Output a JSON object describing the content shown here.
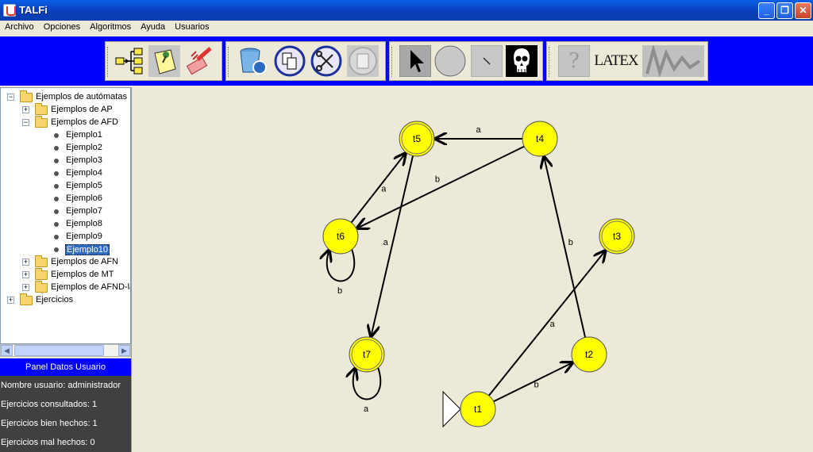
{
  "window": {
    "title": "TALFi",
    "min_label": "_",
    "max_label": "❐",
    "close_label": "✕"
  },
  "menu": [
    "Archivo",
    "Opciones",
    "Algoritmos",
    "Ayuda",
    "Usuarios"
  ],
  "toolbar": {
    "latex_label": "LATEX",
    "help_label": "?"
  },
  "tree": {
    "root": "Ejemplos de autómatas",
    "ap": "Ejemplos de AP",
    "afd": "Ejemplos de AFD",
    "afd_items": [
      "Ejemplo1",
      "Ejemplo2",
      "Ejemplo3",
      "Ejemplo4",
      "Ejemplo5",
      "Ejemplo6",
      "Ejemplo7",
      "Ejemplo8",
      "Ejemplo9",
      "Ejemplo10"
    ],
    "selected": "Ejemplo10",
    "afn": "Ejemplos de AFN",
    "mt": "Ejemplos de MT",
    "afnd": "Ejemplos de AFND-lan",
    "ejercicios": "Ejercicios"
  },
  "user_panel": {
    "header": "Panel Datos Usuario",
    "username": "Nombre usuario: administrador",
    "consulted": "Ejercicios consultados: 1",
    "correct": "Ejercicios bien hechos: 1",
    "wrong": "Ejercicios mal hechos: 0"
  },
  "automaton": {
    "states": [
      {
        "name": "t1",
        "initial": true,
        "final": false
      },
      {
        "name": "t2",
        "initial": false,
        "final": false
      },
      {
        "name": "t3",
        "initial": false,
        "final": true
      },
      {
        "name": "t4",
        "initial": false,
        "final": false
      },
      {
        "name": "t5",
        "initial": false,
        "final": true
      },
      {
        "name": "t6",
        "initial": false,
        "final": false
      },
      {
        "name": "t7",
        "initial": false,
        "final": true
      }
    ],
    "transitions": [
      {
        "from": "t1",
        "to": "t2",
        "label": "b"
      },
      {
        "from": "t1",
        "to": "t3",
        "label": "a"
      },
      {
        "from": "t2",
        "to": "t4",
        "label": "b"
      },
      {
        "from": "t4",
        "to": "t5",
        "label": "a"
      },
      {
        "from": "t4",
        "to": "t6",
        "label": "b"
      },
      {
        "from": "t6",
        "to": "t5",
        "label": "a"
      },
      {
        "from": "t5",
        "to": "t7",
        "label": "a"
      },
      {
        "from": "t6",
        "to": "t6",
        "label": "b"
      },
      {
        "from": "t7",
        "to": "t7",
        "label": "a"
      }
    ],
    "colors": {
      "state_fill": "#ffff00",
      "canvas": "#ece9d8"
    }
  }
}
